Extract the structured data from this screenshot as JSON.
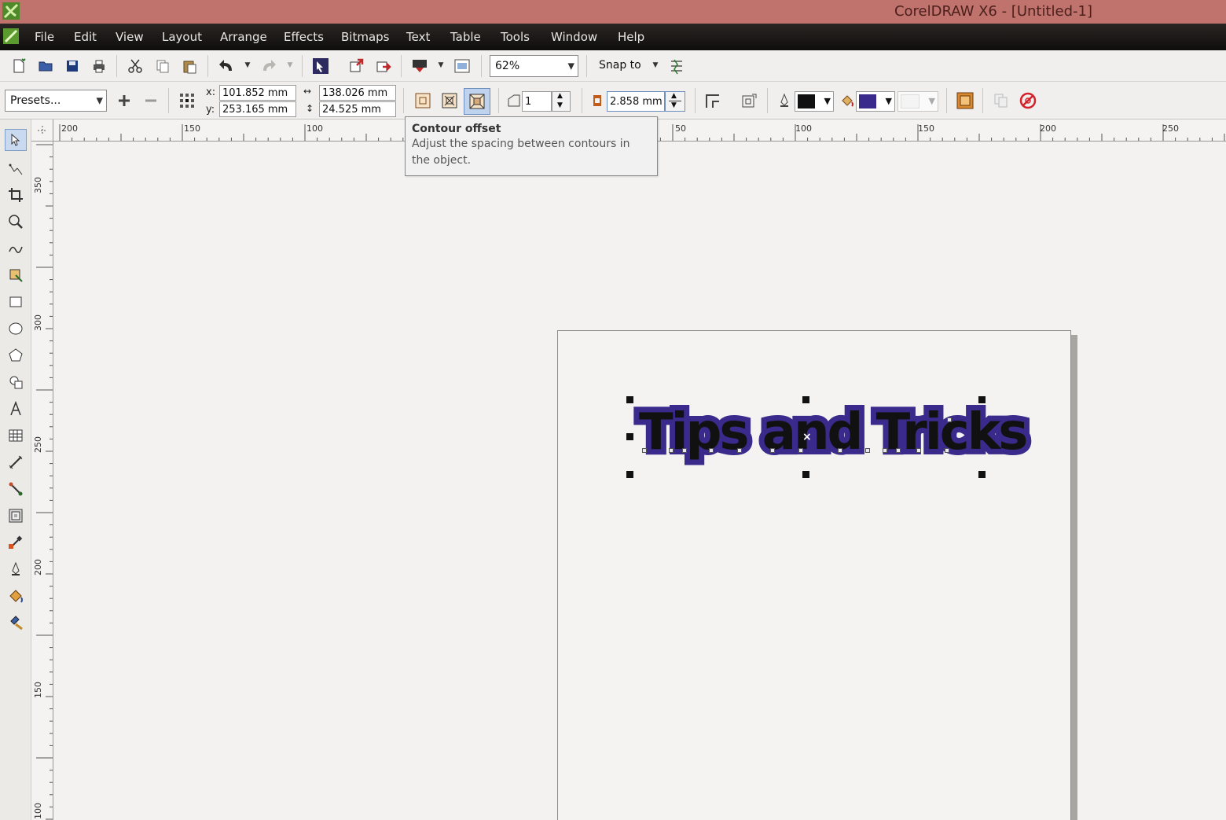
{
  "window": {
    "title": "CorelDRAW X6 - [Untitled-1]"
  },
  "menu": {
    "items": [
      {
        "label": "File"
      },
      {
        "label": "Edit"
      },
      {
        "label": "View"
      },
      {
        "label": "Layout"
      },
      {
        "label": "Arrange"
      },
      {
        "label": "Effects"
      },
      {
        "label": "Bitmaps"
      },
      {
        "label": "Text"
      },
      {
        "label": "Table"
      },
      {
        "label": "Tools"
      },
      {
        "label": "Window"
      },
      {
        "label": "Help"
      }
    ]
  },
  "toolbar": {
    "zoom_value": "62%",
    "snap_label": "Snap to"
  },
  "propbar": {
    "presets_value": "Presets...",
    "x_label": "x:",
    "y_label": "y:",
    "x_value": "101.852 mm",
    "y_value": "253.165 mm",
    "width_value": "138.026 mm",
    "height_value": "24.525 mm",
    "steps_value": "1",
    "offset_value": "2.858 mm",
    "outline_color": "#111111",
    "fill_color": "#3a2a8c",
    "accel_color": "#f4f4f4"
  },
  "tooltip": {
    "title": "Contour offset",
    "body": "Adjust the spacing between contours in the object."
  },
  "hruler": {
    "labels": [
      "200",
      "150",
      "100",
      "50",
      "100",
      "150",
      "200",
      "250"
    ]
  },
  "vruler": {
    "labels": [
      "350",
      "300",
      "250",
      "200",
      "150",
      "100"
    ]
  },
  "artwork": {
    "text": "Tips and Tricks",
    "text_color": "#111111",
    "contour_color": "#3a2a8c"
  }
}
